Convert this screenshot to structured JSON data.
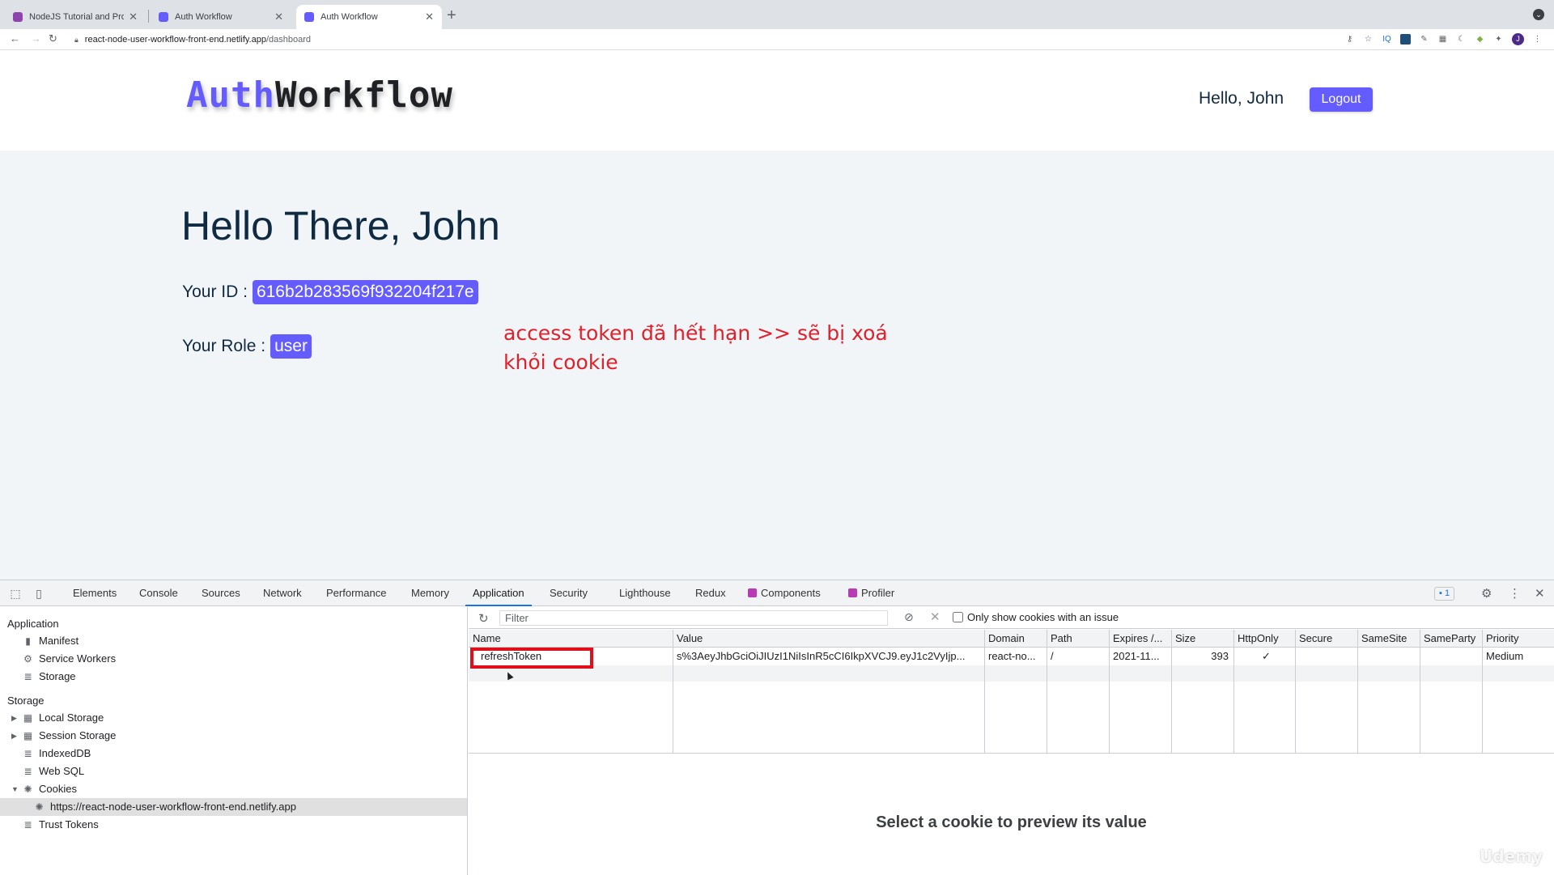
{
  "browser": {
    "tabs": [
      {
        "title": "NodeJS Tutorial and Projects C",
        "color": "#8e44ad"
      },
      {
        "title": "Auth Workflow",
        "color": "#645cff"
      },
      {
        "title": "Auth Workflow",
        "color": "#645cff"
      }
    ],
    "new_tab_label": "+",
    "url_host": "react-node-user-workflow-front-end.netlify.app",
    "url_path": "/dashboard",
    "avatar_letter": "J"
  },
  "site": {
    "logo_auth": "Auth",
    "logo_workflow": "Workflow",
    "hello_user": "Hello, John",
    "logout_label": "Logout",
    "greeting": "Hello There, John",
    "id_label": "Your ID :",
    "id_value": "616b2b283569f932204f217e",
    "role_label": "Your Role :",
    "role_value": "user",
    "accent_color": "#645cff"
  },
  "annotation": {
    "text": "access token đã hết hạn >> sẽ bị xoá khỏi cookie",
    "color": "#e0212b"
  },
  "devtools": {
    "tabs": [
      "Elements",
      "Console",
      "Sources",
      "Network",
      "Performance",
      "Memory",
      "Application",
      "Security",
      "Lighthouse",
      "Redux",
      "Components",
      "Profiler"
    ],
    "active_tab": "Application",
    "issues_count": "1",
    "sidebar": {
      "application_heading": "Application",
      "application_items": [
        "Manifest",
        "Service Workers",
        "Storage"
      ],
      "storage_heading": "Storage",
      "storage_items": [
        "Local Storage",
        "Session Storage",
        "IndexedDB",
        "Web SQL",
        "Cookies"
      ],
      "cookie_origin": "https://react-node-user-workflow-front-end.netlify.app",
      "trust_tokens": "Trust Tokens"
    },
    "filter_placeholder": "Filter",
    "only_issues_label": "Only show cookies with an issue",
    "columns": [
      "Name",
      "Value",
      "Domain",
      "Path",
      "Expires /...",
      "Size",
      "HttpOnly",
      "Secure",
      "SameSite",
      "SameParty",
      "Priority"
    ],
    "rows": [
      {
        "name": "refreshToken",
        "value": "s%3AeyJhbGciOiJIUzI1NiIsInR5cCI6IkpXVCJ9.eyJ1c2VyIjp...",
        "domain": "react-no...",
        "path": "/",
        "expires": "2021-11...",
        "size": "393",
        "httponly": "✓",
        "secure": "",
        "samesite": "",
        "sameparty": "",
        "priority": "Medium"
      }
    ],
    "preview_message": "Select a cookie to preview its value"
  },
  "watermark": "Udemy"
}
